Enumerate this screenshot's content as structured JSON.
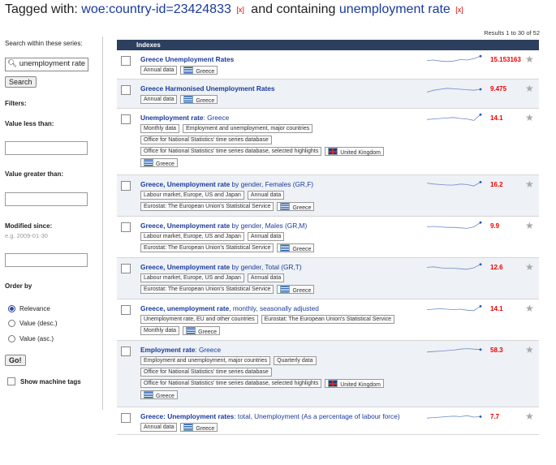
{
  "header": {
    "prefix": "Tagged with:",
    "tag": "woe:country-id=23424833",
    "remove": "[x]",
    "middle": "and containing",
    "term": "unemployment rate",
    "remove2": "[x]"
  },
  "sidebar": {
    "search_label": "Search within these series:",
    "search_value": "unemployment rate",
    "search_button": "Search",
    "filters": "Filters:",
    "less_than": "Value less than:",
    "greater_than": "Value greater than:",
    "modified_since": "Modified since:",
    "modified_hint": "e.g. 2009-01-30",
    "order_by": "Order by",
    "orders": [
      "Relevance",
      "Value (desc.)",
      "Value (asc.)"
    ],
    "selected_order": 0,
    "go_button": "Go!",
    "machine_tags": "Show machine tags"
  },
  "results": {
    "count": "Results 1 to 30 of 52",
    "column": "Indexes",
    "rows": [
      {
        "title_bold": "Greece Unemployment Rates",
        "title_rest": "",
        "value": "15.153163",
        "spark": [
          0.55,
          0.5,
          0.6,
          0.65,
          0.6,
          0.45,
          0.5,
          0.35,
          0.1
        ],
        "tags": [
          [
            {
              "t": "Annual data"
            },
            {
              "t": "Greece",
              "flag": "gr"
            }
          ]
        ]
      },
      {
        "title_bold": "Greece Harmonised Unemployment Rates",
        "title_rest": "",
        "value": "9.475",
        "spark": [
          0.8,
          0.6,
          0.5,
          0.4,
          0.45,
          0.5,
          0.55,
          0.6,
          0.5
        ],
        "tags": [
          [
            {
              "t": "Annual data"
            },
            {
              "t": "Greece",
              "flag": "gr"
            }
          ]
        ]
      },
      {
        "title_bold": "Unemployment rate",
        "title_rest": ": Greece",
        "value": "14.1",
        "spark": [
          0.6,
          0.55,
          0.5,
          0.45,
          0.4,
          0.5,
          0.55,
          0.7,
          0.1
        ],
        "tags": [
          [
            {
              "t": "Monthly data"
            },
            {
              "t": "Employment and unemployment, major countries"
            }
          ],
          [
            {
              "t": "Office for National Statistics' time series database"
            }
          ],
          [
            {
              "t": "Office for National Statistics' time series database, selected highlights"
            },
            {
              "t": "United Kingdom",
              "flag": "uk"
            }
          ],
          [
            {
              "t": "Greece",
              "flag": "gr"
            }
          ]
        ]
      },
      {
        "title_bold": "Greece, Unemployment rate",
        "title_rest": " by gender, Females (GR,F)",
        "value": "16.2",
        "spark": [
          0.3,
          0.4,
          0.45,
          0.5,
          0.5,
          0.4,
          0.45,
          0.6,
          0.2
        ],
        "tags": [
          [
            {
              "t": "Labour market, Europe, US and Japan"
            },
            {
              "t": "Annual data"
            }
          ],
          [
            {
              "t": "Eurostat: The European Union's Statistical Service"
            },
            {
              "t": "Greece",
              "flag": "gr"
            }
          ]
        ]
      },
      {
        "title_bold": "Greece, Unemployment rate",
        "title_rest": " by gender, Males (GR,M)",
        "value": "9.9",
        "spark": [
          0.55,
          0.5,
          0.55,
          0.6,
          0.6,
          0.65,
          0.7,
          0.55,
          0.1
        ],
        "tags": [
          [
            {
              "t": "Labour market, Europe, US and Japan"
            },
            {
              "t": "Annual data"
            }
          ],
          [
            {
              "t": "Eurostat: The European Union's Statistical Service"
            },
            {
              "t": "Greece",
              "flag": "gr"
            }
          ]
        ]
      },
      {
        "title_bold": "Greece, Unemployment rate",
        "title_rest": " by gender, Total (GR,T)",
        "value": "12.6",
        "spark": [
          0.45,
          0.4,
          0.5,
          0.55,
          0.55,
          0.6,
          0.65,
          0.5,
          0.15
        ],
        "tags": [
          [
            {
              "t": "Labour market, Europe, US and Japan"
            },
            {
              "t": "Annual data"
            }
          ],
          [
            {
              "t": "Eurostat: The European Union's Statistical Service"
            },
            {
              "t": "Greece",
              "flag": "gr"
            }
          ]
        ]
      },
      {
        "title_bold": "Greece, unemployment rate",
        "title_rest": ", monthly, seasonally adjusted",
        "value": "14.1",
        "spark": [
          0.55,
          0.5,
          0.45,
          0.5,
          0.55,
          0.5,
          0.6,
          0.65,
          0.2
        ],
        "tags": [
          [
            {
              "t": "Unemployment rate, EU and other countries"
            },
            {
              "t": "Eurostat: The European Union's Statistical Service"
            }
          ],
          [
            {
              "t": "Monthly data"
            },
            {
              "t": "Greece",
              "flag": "gr"
            }
          ]
        ]
      },
      {
        "title_bold": "Employment rate",
        "title_rest": ": Greece",
        "value": "58.3",
        "spark": [
          0.65,
          0.6,
          0.55,
          0.5,
          0.45,
          0.35,
          0.3,
          0.35,
          0.4
        ],
        "tags": [
          [
            {
              "t": "Employment and unemployment, major countries"
            },
            {
              "t": "Quarterly data"
            }
          ],
          [
            {
              "t": "Office for National Statistics' time series database"
            }
          ],
          [
            {
              "t": "Office for National Statistics' time series database, selected highlights"
            },
            {
              "t": "United Kingdom",
              "flag": "uk"
            }
          ],
          [
            {
              "t": "Greece",
              "flag": "gr"
            }
          ]
        ]
      },
      {
        "title_bold": "Greece: Unemployment rates",
        "title_rest": ": total, Unemployment (As a percentage of labour force)",
        "value": "7.7",
        "spark": [
          0.6,
          0.55,
          0.5,
          0.45,
          0.4,
          0.45,
          0.35,
          0.5,
          0.45
        ],
        "tags": [
          [
            {
              "t": "Annual data"
            },
            {
              "t": "Greece",
              "flag": "gr"
            }
          ]
        ]
      }
    ]
  }
}
